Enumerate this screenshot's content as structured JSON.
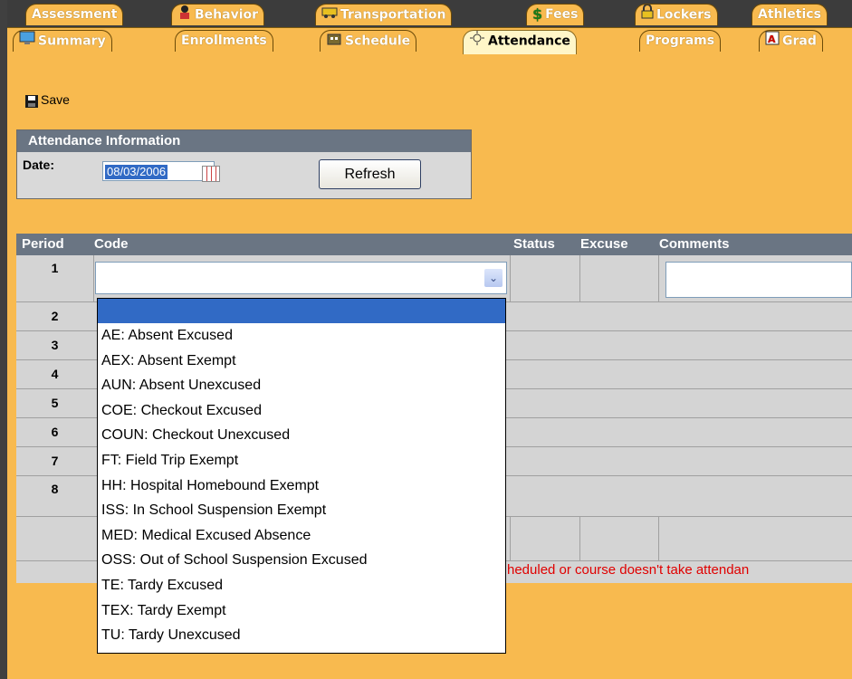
{
  "tabs_row1": [
    {
      "label": "Assessment",
      "icon": "none"
    },
    {
      "label": "Behavior",
      "icon": "person-icon"
    },
    {
      "label": "Transportation",
      "icon": "bus-icon"
    },
    {
      "label": "Fees",
      "icon": "dollar-icon"
    },
    {
      "label": "Lockers",
      "icon": "lock-icon"
    },
    {
      "label": "Athletics",
      "icon": "none"
    }
  ],
  "tabs_row2": [
    {
      "label": "Summary",
      "icon": "monitor-icon"
    },
    {
      "label": "Enrollments",
      "icon": "none"
    },
    {
      "label": "Schedule",
      "icon": "building-icon"
    },
    {
      "label": "Attendance",
      "icon": "sun-icon",
      "active": true
    },
    {
      "label": "Programs",
      "icon": "none"
    },
    {
      "label": "Grad",
      "icon": "grade-icon"
    }
  ],
  "toolbar": {
    "save_label": "Save"
  },
  "attendance_info": {
    "title": "Attendance Information",
    "date_label": "Date:",
    "date_value": "08/03/2006",
    "refresh_label": "Refresh"
  },
  "grid": {
    "headers": {
      "period": "Period",
      "code": "Code",
      "status": "Status",
      "excuse": "Excuse",
      "comments": "Comments"
    },
    "periods": [
      "1",
      "2",
      "3",
      "4",
      "5",
      "6",
      "7",
      "8"
    ],
    "warning": "heduled or course doesn't take attendan"
  },
  "code_dropdown": {
    "selected": "",
    "options": [
      "",
      "AE: Absent Excused",
      "AEX: Absent Exempt",
      "AUN: Absent Unexcused",
      "COE: Checkout Excused",
      "COUN: Checkout Unexcused",
      "FT: Field Trip Exempt",
      "HH: Hospital Homebound Exempt",
      "ISS: In School Suspension Exempt",
      "MED: Medical Excused Absence",
      "OSS: Out of School Suspension Excused",
      "TE: Tardy Excused",
      "TEX: Tardy Exempt",
      "TU: Tardy Unexcused"
    ]
  },
  "colors": {
    "accent": "#f8ba4f",
    "header": "#6a7583",
    "selection": "#316ac5",
    "warning": "#e00000"
  }
}
